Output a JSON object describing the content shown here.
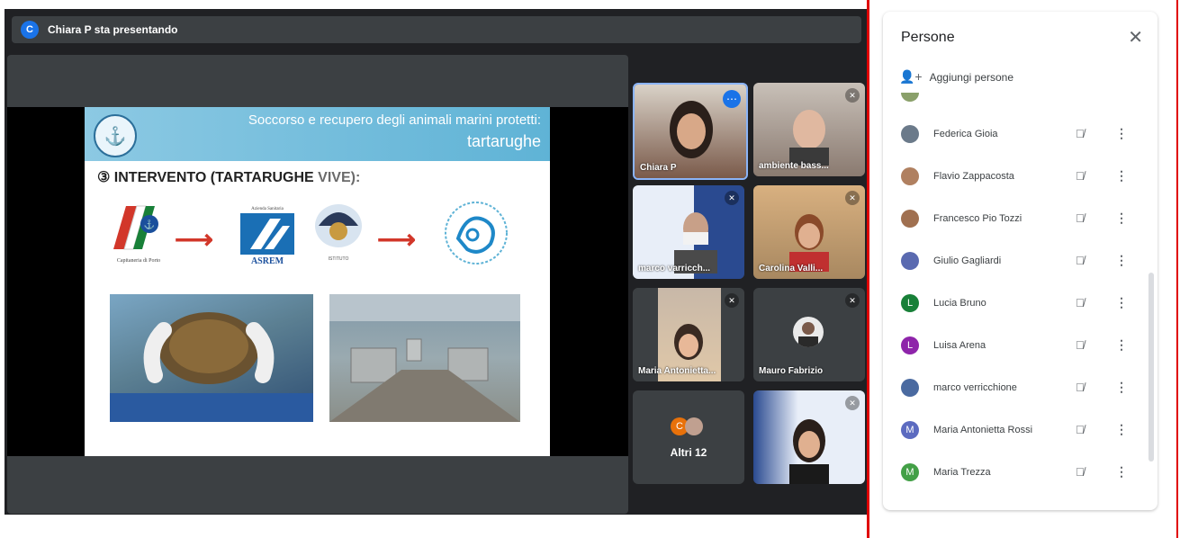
{
  "presenter_bar": {
    "avatar_letter": "C",
    "text": "Chiara P sta presentando"
  },
  "slide": {
    "title_line1": "Soccorso e recupero degli animali marini protetti:",
    "title_line2": "tartarughe",
    "subtitle_num": "③ ",
    "subtitle_main": "INTERVENTO (TARTARUGHE ",
    "subtitle_rest": "VIVE):",
    "logos": [
      "Capitaneria di Porto Guardia Costiera",
      "ASREM",
      "Istituto",
      "Centro Recupero"
    ],
    "logo_text_asrem": "ASREM"
  },
  "tiles": [
    {
      "name": "Chiara P",
      "color": "#7a5a4a",
      "has_more": true
    },
    {
      "name": "ambiente bass...",
      "color": "#9a8a80",
      "muted": true
    },
    {
      "name": "marco varricch...",
      "color": "#4a6aa0",
      "muted": true
    },
    {
      "name": "Carolina Valli...",
      "color": "#b08a60",
      "muted": true
    },
    {
      "name": "Maria Antonietta...",
      "color": "#c8a080",
      "muted": true
    },
    {
      "name": "Mauro Fabrizio",
      "color": "#3c4043",
      "muted": true
    },
    {
      "name": "Altri 12",
      "color": "#3c4043"
    },
    {
      "name": "",
      "color": "#5070b0",
      "muted": true
    }
  ],
  "panel": {
    "title": "Persone",
    "add_label": "Aggiungi persone",
    "people": [
      {
        "name": "Federica Gioia",
        "avatar": "",
        "color": "#6b7a8a"
      },
      {
        "name": "Flavio Zappacosta",
        "avatar": "",
        "color": "#b08060"
      },
      {
        "name": "Francesco Pio Tozzi",
        "avatar": "",
        "color": "#a07050"
      },
      {
        "name": "Giulio Gagliardi",
        "avatar": "",
        "color": "#5a6ab0"
      },
      {
        "name": "Lucia Bruno",
        "avatar": "L",
        "color": "#188038"
      },
      {
        "name": "Luisa Arena",
        "avatar": "L",
        "color": "#8e24aa"
      },
      {
        "name": "marco verricchione",
        "avatar": "",
        "color": "#4a6aa0"
      },
      {
        "name": "Maria Antonietta Rossi",
        "avatar": "M",
        "color": "#5c6bc0"
      },
      {
        "name": "Maria Trezza",
        "avatar": "M",
        "color": "#43a047"
      }
    ]
  }
}
